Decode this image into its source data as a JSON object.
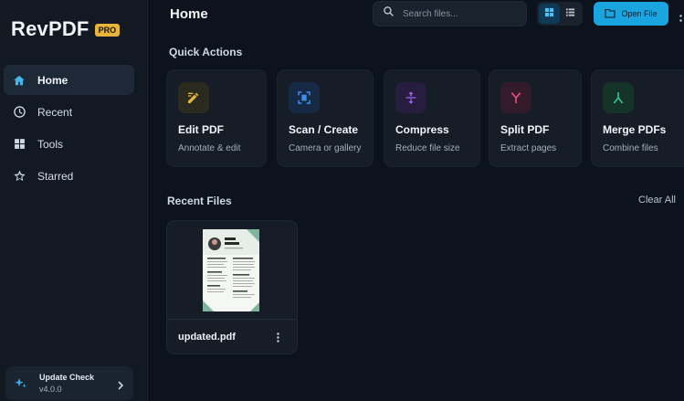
{
  "app": {
    "name": "RevPDF",
    "badge": "PRO"
  },
  "sidebar": {
    "items": [
      {
        "label": "Home",
        "icon": "home-icon",
        "active": true
      },
      {
        "label": "Recent",
        "icon": "clock-icon",
        "active": false
      },
      {
        "label": "Tools",
        "icon": "grid-icon",
        "active": false
      },
      {
        "label": "Starred",
        "icon": "star-icon",
        "active": false
      }
    ],
    "update": {
      "title": "Update Check",
      "version": "v4.0.0"
    }
  },
  "header": {
    "title": "Home",
    "search_placeholder": "Search files...",
    "open_file_label": "Open File"
  },
  "quick_actions": {
    "title": "Quick Actions",
    "cards": [
      {
        "title": "Edit PDF",
        "subtitle": "Annotate & edit",
        "icon": "edit-icon",
        "color": "#e6b43c"
      },
      {
        "title": "Scan / Create",
        "subtitle": "Camera or gallery",
        "icon": "scan-icon",
        "color": "#3a8ef0"
      },
      {
        "title": "Compress",
        "subtitle": "Reduce file size",
        "icon": "compress-icon",
        "color": "#a466f2"
      },
      {
        "title": "Split PDF",
        "subtitle": "Extract pages",
        "icon": "split-icon",
        "color": "#ea4f8a"
      },
      {
        "title": "Merge PDFs",
        "subtitle": "Combine files",
        "icon": "merge-icon",
        "color": "#36c48f"
      }
    ]
  },
  "recent_files": {
    "title": "Recent Files",
    "clear_label": "Clear All",
    "files": [
      {
        "name": "updated.pdf"
      }
    ]
  },
  "colors": {
    "accent": "#1aa4e0",
    "background": "#0d131c",
    "sidebar": "#121923",
    "card": "#161d27",
    "badge": "#e9b43a"
  }
}
